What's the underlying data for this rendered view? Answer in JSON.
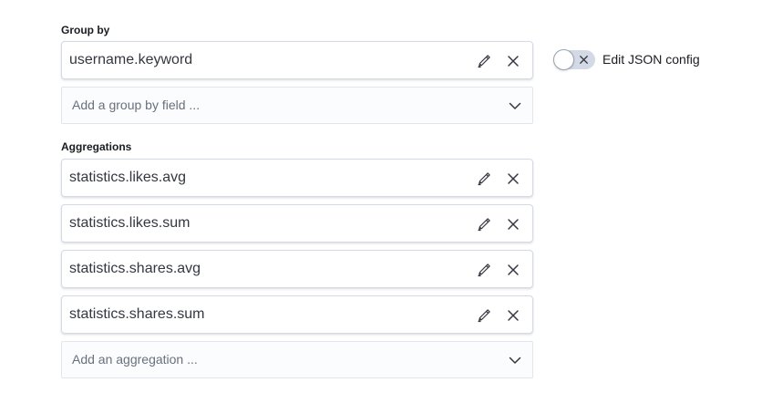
{
  "group_by": {
    "label": "Group by",
    "items": [
      {
        "text": "username.keyword",
        "edit_icon": "pencil-icon",
        "remove_icon": "close-icon"
      }
    ],
    "add_placeholder": "Add a group by field ..."
  },
  "aggregations": {
    "label": "Aggregations",
    "items": [
      {
        "text": "statistics.likes.avg",
        "edit_icon": "pencil-icon",
        "remove_icon": "close-icon"
      },
      {
        "text": "statistics.likes.sum",
        "edit_icon": "pencil-icon",
        "remove_icon": "close-icon"
      },
      {
        "text": "statistics.shares.avg",
        "edit_icon": "pencil-icon",
        "remove_icon": "close-icon"
      },
      {
        "text": "statistics.shares.sum",
        "edit_icon": "pencil-icon",
        "remove_icon": "close-icon"
      }
    ],
    "add_placeholder": "Add an aggregation ..."
  },
  "json_config_toggle": {
    "label": "Edit JSON config",
    "checked": false
  },
  "colors": {
    "text": "#343741",
    "border": "#d3dae6",
    "placeholder": "#69707d",
    "icon": "#343741"
  }
}
